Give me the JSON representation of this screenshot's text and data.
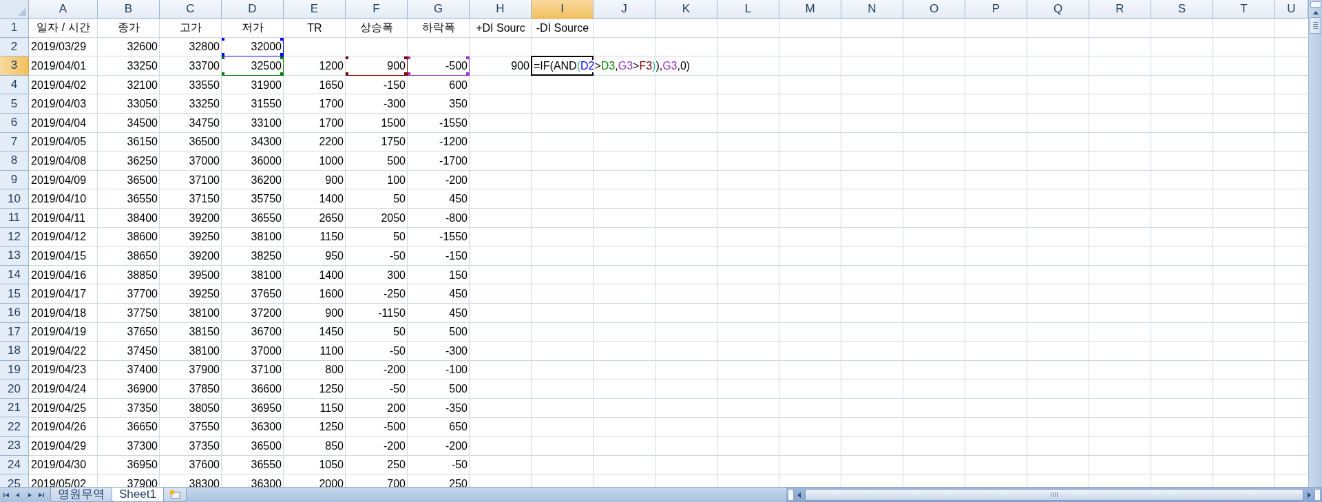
{
  "columns": [
    {
      "label": "A",
      "selected": false
    },
    {
      "label": "B",
      "selected": false
    },
    {
      "label": "C",
      "selected": false
    },
    {
      "label": "D",
      "selected": false
    },
    {
      "label": "E",
      "selected": false
    },
    {
      "label": "F",
      "selected": false
    },
    {
      "label": "G",
      "selected": false
    },
    {
      "label": "H",
      "selected": false
    },
    {
      "label": "I",
      "selected": true
    },
    {
      "label": "J",
      "selected": false
    },
    {
      "label": "K",
      "selected": false
    },
    {
      "label": "L",
      "selected": false
    },
    {
      "label": "M",
      "selected": false
    },
    {
      "label": "N",
      "selected": false
    },
    {
      "label": "O",
      "selected": false
    },
    {
      "label": "P",
      "selected": false
    },
    {
      "label": "Q",
      "selected": false
    },
    {
      "label": "R",
      "selected": false
    },
    {
      "label": "S",
      "selected": false
    },
    {
      "label": "T",
      "selected": false
    },
    {
      "label": "U",
      "selected": false
    }
  ],
  "rows": [
    {
      "label": "1",
      "selected": false,
      "kind": "heading",
      "cells": [
        "일자 / 시간",
        "종가",
        "고가",
        "저가",
        "TR",
        "상승폭",
        "하락폭",
        "+DI Sourc",
        "-DI Source"
      ]
    },
    {
      "label": "2",
      "selected": false,
      "kind": "data",
      "cells": [
        "2019/03/29",
        "32600",
        "32800",
        {
          "value": "32000",
          "color": "#0000ff"
        }
      ]
    },
    {
      "label": "3",
      "selected": true,
      "kind": "data",
      "cells": [
        "2019/04/01",
        "33250",
        "33700",
        {
          "value": "32500",
          "color": "#008000"
        },
        "1200",
        {
          "value": "900",
          "color": "#800000"
        },
        {
          "value": "-500",
          "color": "#9933cc"
        },
        "900",
        {
          "active": true,
          "formula": [
            {
              "text": "=IF(AND"
            },
            {
              "text": "(",
              "color": "#33aaaa"
            },
            {
              "text": "D2",
              "color": "#0000ff"
            },
            {
              "text": ">"
            },
            {
              "text": "D3",
              "color": "#008000"
            },
            {
              "text": ","
            },
            {
              "text": "G3",
              "color": "#9933cc"
            },
            {
              "text": ">"
            },
            {
              "text": "F3",
              "color": "#800000"
            },
            {
              "text": ")",
              "color": "#33aaaa"
            },
            {
              "text": "),"
            },
            {
              "text": "G3",
              "color": "#9933cc"
            },
            {
              "text": ",0)"
            }
          ]
        }
      ]
    },
    {
      "label": "4",
      "selected": false,
      "kind": "data",
      "cells": [
        "2019/04/02",
        "32100",
        "33550",
        "31900",
        "1650",
        "-150",
        "600"
      ]
    },
    {
      "label": "5",
      "selected": false,
      "kind": "data",
      "cells": [
        "2019/04/03",
        "33050",
        "33250",
        "31550",
        "1700",
        "-300",
        "350"
      ]
    },
    {
      "label": "6",
      "selected": false,
      "kind": "data",
      "cells": [
        "2019/04/04",
        "34500",
        "34750",
        "33100",
        "1700",
        "1500",
        "-1550"
      ]
    },
    {
      "label": "7",
      "selected": false,
      "kind": "data",
      "cells": [
        "2019/04/05",
        "36150",
        "36500",
        "34300",
        "2200",
        "1750",
        "-1200"
      ]
    },
    {
      "label": "8",
      "selected": false,
      "kind": "data",
      "cells": [
        "2019/04/08",
        "36250",
        "37000",
        "36000",
        "1000",
        "500",
        "-1700"
      ]
    },
    {
      "label": "9",
      "selected": false,
      "kind": "data",
      "cells": [
        "2019/04/09",
        "36500",
        "37100",
        "36200",
        "900",
        "100",
        "-200"
      ]
    },
    {
      "label": "10",
      "selected": false,
      "kind": "data",
      "cells": [
        "2019/04/10",
        "36550",
        "37150",
        "35750",
        "1400",
        "50",
        "450"
      ]
    },
    {
      "label": "11",
      "selected": false,
      "kind": "data",
      "cells": [
        "2019/04/11",
        "38400",
        "39200",
        "36550",
        "2650",
        "2050",
        "-800"
      ]
    },
    {
      "label": "12",
      "selected": false,
      "kind": "data",
      "cells": [
        "2019/04/12",
        "38600",
        "39250",
        "38100",
        "1150",
        "50",
        "-1550"
      ]
    },
    {
      "label": "13",
      "selected": false,
      "kind": "data",
      "cells": [
        "2019/04/15",
        "38650",
        "39200",
        "38250",
        "950",
        "-50",
        "-150"
      ]
    },
    {
      "label": "14",
      "selected": false,
      "kind": "data",
      "cells": [
        "2019/04/16",
        "38850",
        "39500",
        "38100",
        "1400",
        "300",
        "150"
      ]
    },
    {
      "label": "15",
      "selected": false,
      "kind": "data",
      "cells": [
        "2019/04/17",
        "37700",
        "39250",
        "37650",
        "1600",
        "-250",
        "450"
      ]
    },
    {
      "label": "16",
      "selected": false,
      "kind": "data",
      "cells": [
        "2019/04/18",
        "37750",
        "38100",
        "37200",
        "900",
        "-1150",
        "450"
      ]
    },
    {
      "label": "17",
      "selected": false,
      "kind": "data",
      "cells": [
        "2019/04/19",
        "37650",
        "38150",
        "36700",
        "1450",
        "50",
        "500"
      ]
    },
    {
      "label": "18",
      "selected": false,
      "kind": "data",
      "cells": [
        "2019/04/22",
        "37450",
        "38100",
        "37000",
        "1100",
        "-50",
        "-300"
      ]
    },
    {
      "label": "19",
      "selected": false,
      "kind": "data",
      "cells": [
        "2019/04/23",
        "37400",
        "37900",
        "37100",
        "800",
        "-200",
        "-100"
      ]
    },
    {
      "label": "20",
      "selected": false,
      "kind": "data",
      "cells": [
        "2019/04/24",
        "36900",
        "37850",
        "36600",
        "1250",
        "-50",
        "500"
      ]
    },
    {
      "label": "21",
      "selected": false,
      "kind": "data",
      "cells": [
        "2019/04/25",
        "37350",
        "38050",
        "36950",
        "1150",
        "200",
        "-350"
      ]
    },
    {
      "label": "22",
      "selected": false,
      "kind": "data",
      "cells": [
        "2019/04/26",
        "36650",
        "37550",
        "36300",
        "1250",
        "-500",
        "650"
      ]
    },
    {
      "label": "23",
      "selected": false,
      "kind": "data",
      "cells": [
        "2019/04/29",
        "37300",
        "37350",
        "36500",
        "850",
        "-200",
        "-200"
      ]
    },
    {
      "label": "24",
      "selected": false,
      "kind": "data",
      "cells": [
        "2019/04/30",
        "36950",
        "37600",
        "36550",
        "1050",
        "250",
        "-50"
      ]
    },
    {
      "label": "25",
      "selected": false,
      "kind": "data",
      "cells": [
        "2019/05/02",
        "37900",
        "38300",
        "36300",
        "2000",
        "700",
        "250"
      ]
    }
  ],
  "sheet_tabs": [
    {
      "label": "영원무역",
      "selected": false
    },
    {
      "label": "Sheet1",
      "selected": true
    }
  ]
}
